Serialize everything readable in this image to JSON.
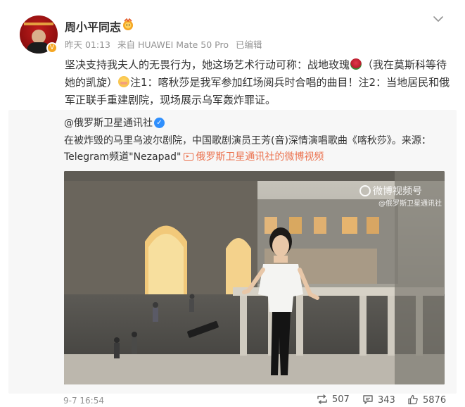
{
  "post": {
    "username": "周小平同志",
    "time": "昨天 01:13",
    "source": "来自 HUAWEI Mate 50 Pro",
    "edited": "已编辑",
    "text_part1": "坚决支持我夫人的无畏行为，她这场艺术行动可称：战地玫瑰",
    "text_part2": "（我在莫斯科等待她的凯旋）",
    "text_part3": "注1：喀秋莎是我军参加红场阅兵时合唱的曲目！注2：当地居民和俄军正联手重建剧院，现场展示乌军轰炸罪证。"
  },
  "repost": {
    "author": "@俄罗斯卫星通讯社",
    "text": "在被炸毁的马里乌波尔剧院，中国歌剧演员王芳(音)深情演唱歌曲《喀秋莎》。来源：Telegram频道\"Nezapad\"",
    "link_text": "俄罗斯卫星通讯社的微博视频",
    "watermark": "微博视频号",
    "watermark_sub": "@俄罗斯卫星通讯社"
  },
  "footer": {
    "timestamp": "9-7 16:54",
    "reposts": "507",
    "comments": "343",
    "likes": "5876"
  },
  "icons": {
    "medal": "medal-icon",
    "more": "chevron-down-icon",
    "repost": "repost-icon",
    "comment": "comment-icon",
    "like": "like-icon"
  },
  "colors": {
    "link": "#eb7350",
    "verified_blue": "#2f8ffd",
    "verified_gold": "#f5a623"
  }
}
